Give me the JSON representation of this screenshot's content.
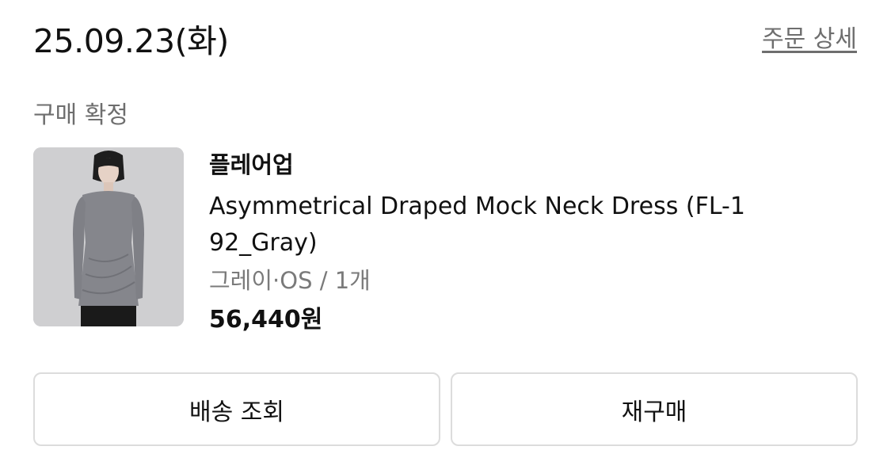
{
  "order": {
    "date": "25.09.23(화)",
    "detail_link": "주문 상세",
    "status": "구매 확정"
  },
  "product": {
    "image_icon": "product-photo-gray-dress",
    "brand": "플레어업",
    "name": "Asymmetrical Draped Mock Neck Dress (FL-192_Gray)",
    "option": "그레이·OS / 1개",
    "price": "56,440원"
  },
  "actions": {
    "track_label": "배송 조회",
    "rebuy_label": "재구매"
  },
  "colors": {
    "border": "#dcdcdc",
    "secondary_text": "#6e6e6e",
    "primary_text": "#111111"
  }
}
